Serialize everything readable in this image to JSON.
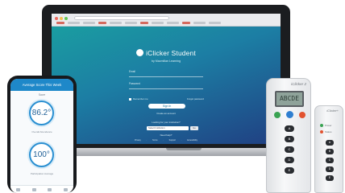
{
  "colors": {
    "accent": "#1e88c9",
    "screen_gradient_start": "#1aa2a0",
    "screen_gradient_end": "#203f82",
    "clicker_red": "#e2522f",
    "clicker_green": "#3aa353",
    "clicker_blue": "#2f7fd0"
  },
  "laptop": {
    "brand_name": "iClicker Student",
    "tagline": "by Macmillan Learning",
    "email_label": "Email",
    "password_label": "Password",
    "remember_label": "Remember me",
    "forgot_link": "Forgot password",
    "signin_button": "Sign In",
    "create_account_link": "Create an account",
    "institution_prompt": "Looking for your institution?",
    "institution_select": "Select Institution",
    "go_button": "Go",
    "help_link": "Need help?",
    "footer": "Privacy · Terms · Support · Accessibility"
  },
  "phone": {
    "header": "Average Score This Week",
    "subtitle": "Score",
    "gauge1_value": "86.2°",
    "gauge1_label": "Overall Attendance",
    "gauge2_value": "100°",
    "gauge2_label": "Participation Average"
  },
  "clicker_big": {
    "brand": "iClicker 2",
    "display": "ABCDE",
    "keys": [
      "A",
      "B",
      "C",
      "D",
      "E"
    ]
  },
  "clicker_small": {
    "brand": "iClicker+",
    "labels": [
      "Power",
      "Status"
    ],
    "keys": [
      "A",
      "B",
      "C",
      "D",
      "E"
    ]
  }
}
